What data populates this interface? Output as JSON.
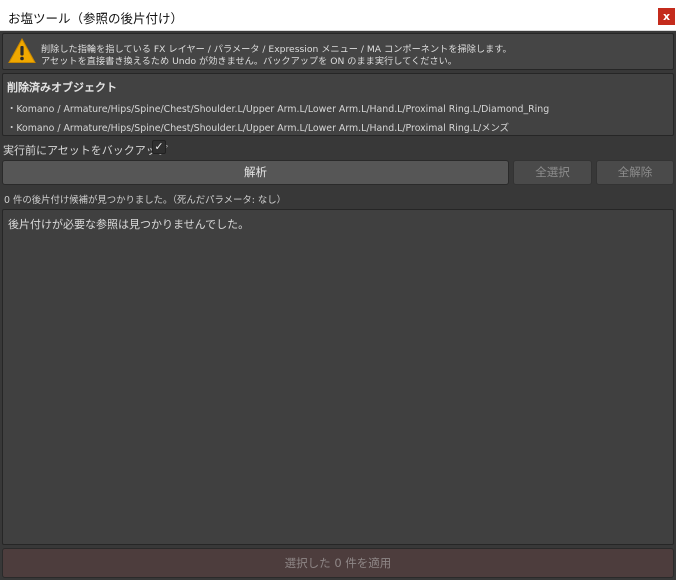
{
  "window": {
    "title": "お塩ツール（参照の後片付け）",
    "close_label": "x"
  },
  "warning": {
    "line1": "削除した指輪を指している FX レイヤー / パラメータ / Expression メニュー / MA コンポーネントを掃除します。",
    "line2": "アセットを直接書き換えるため Undo が効きません。バックアップを ON のまま実行してください。",
    "icon": "warning-triangle-icon",
    "icon_color": "#f0a800"
  },
  "deleted": {
    "title": "削除済みオブジェクト",
    "items": [
      "・Komano / Armature/Hips/Spine/Chest/Shoulder.L/Upper Arm.L/Lower Arm.L/Hand.L/Proximal Ring.L/Diamond_Ring",
      "・Komano / Armature/Hips/Spine/Chest/Shoulder.L/Upper Arm.L/Lower Arm.L/Hand.L/Proximal Ring.L/メンズ"
    ]
  },
  "backup": {
    "label": "実行前にアセットをバックアップ",
    "checked": true,
    "check_glyph": "✓"
  },
  "toolbar": {
    "analyze_label": "解析",
    "select_all_label": "全選択",
    "deselect_all_label": "全解除"
  },
  "status": {
    "text": "0 件の後片付け候補が見つかりました。（死んだパラメータ: なし）"
  },
  "results": {
    "empty_message": "後片付けが必要な参照は見つかりませんでした。"
  },
  "footer": {
    "apply_label": "選択した 0 件を適用"
  }
}
